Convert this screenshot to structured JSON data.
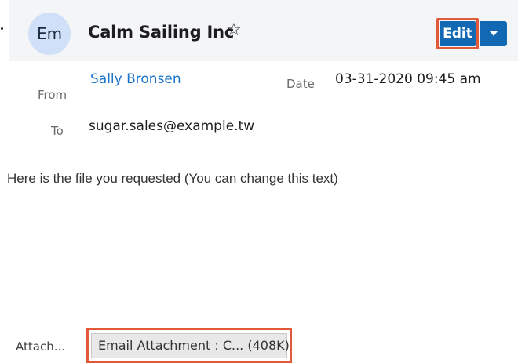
{
  "header": {
    "avatar_initials": "Em",
    "title": "Calm Sailing Inc",
    "favorite_icon": "star-outline-icon",
    "edit_label": "Edit",
    "actions_icon": "caret-down-icon",
    "accent_color": "#1268b3"
  },
  "fields": {
    "from_label": "From",
    "from_value": "Sally Bronsen",
    "date_label": "Date",
    "date_value": "03-31-2020 09:45 am",
    "to_label": "To",
    "to_value": "sugar.sales@example.tw"
  },
  "body": {
    "text": "Here is the file you requested (You can change this text)"
  },
  "attachments": {
    "label": "Attach...",
    "item": "Email Attachment : C... (408K)"
  },
  "highlight_color": "#e05a3a"
}
